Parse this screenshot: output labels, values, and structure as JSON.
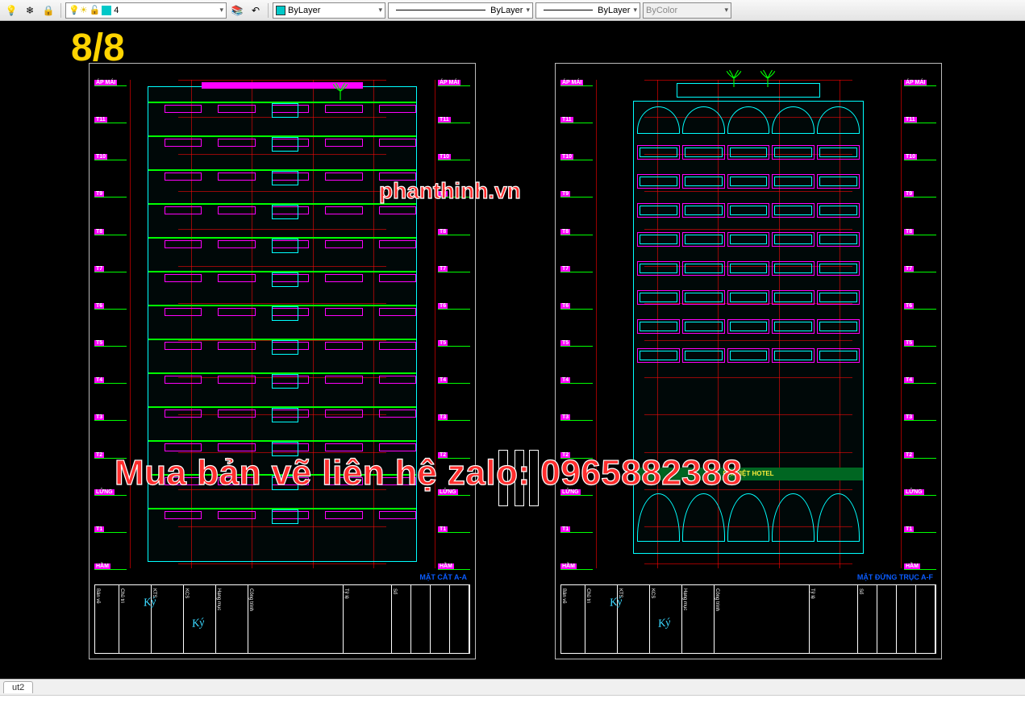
{
  "toolbar": {
    "layer_value": "4",
    "color_value": "ByLayer",
    "linetype_value": "ByLayer",
    "lineweight_value": "ByLayer",
    "plotstyle_value": "ByColor",
    "layer_color": "#00c8c8"
  },
  "page_number": "8/8",
  "watermark_site": "phanthinh.vn",
  "watermark_contact": "Mua bản vẽ liên hệ zalo: 0965882388",
  "tabs": {
    "layout2": "ut2"
  },
  "floors": [
    "ÁP MÁI",
    "T11",
    "T10",
    "T9",
    "T8",
    "T7",
    "T6",
    "T5",
    "T4",
    "T3",
    "T2",
    "LỬNG",
    "T1",
    "HẦM"
  ],
  "section_title_left": "MẶT CẮT A-A",
  "section_title_right": "MẶT ĐỨNG TRỤC A-F",
  "building_sign": "ĐẠI VIỆT HOTEL",
  "titleblock_cols": [
    "Bản vẽ",
    "Chủ trì",
    "KTS",
    "KCS",
    "Hạng mục",
    "Công trình",
    "Tỷ lệ",
    "Số"
  ]
}
